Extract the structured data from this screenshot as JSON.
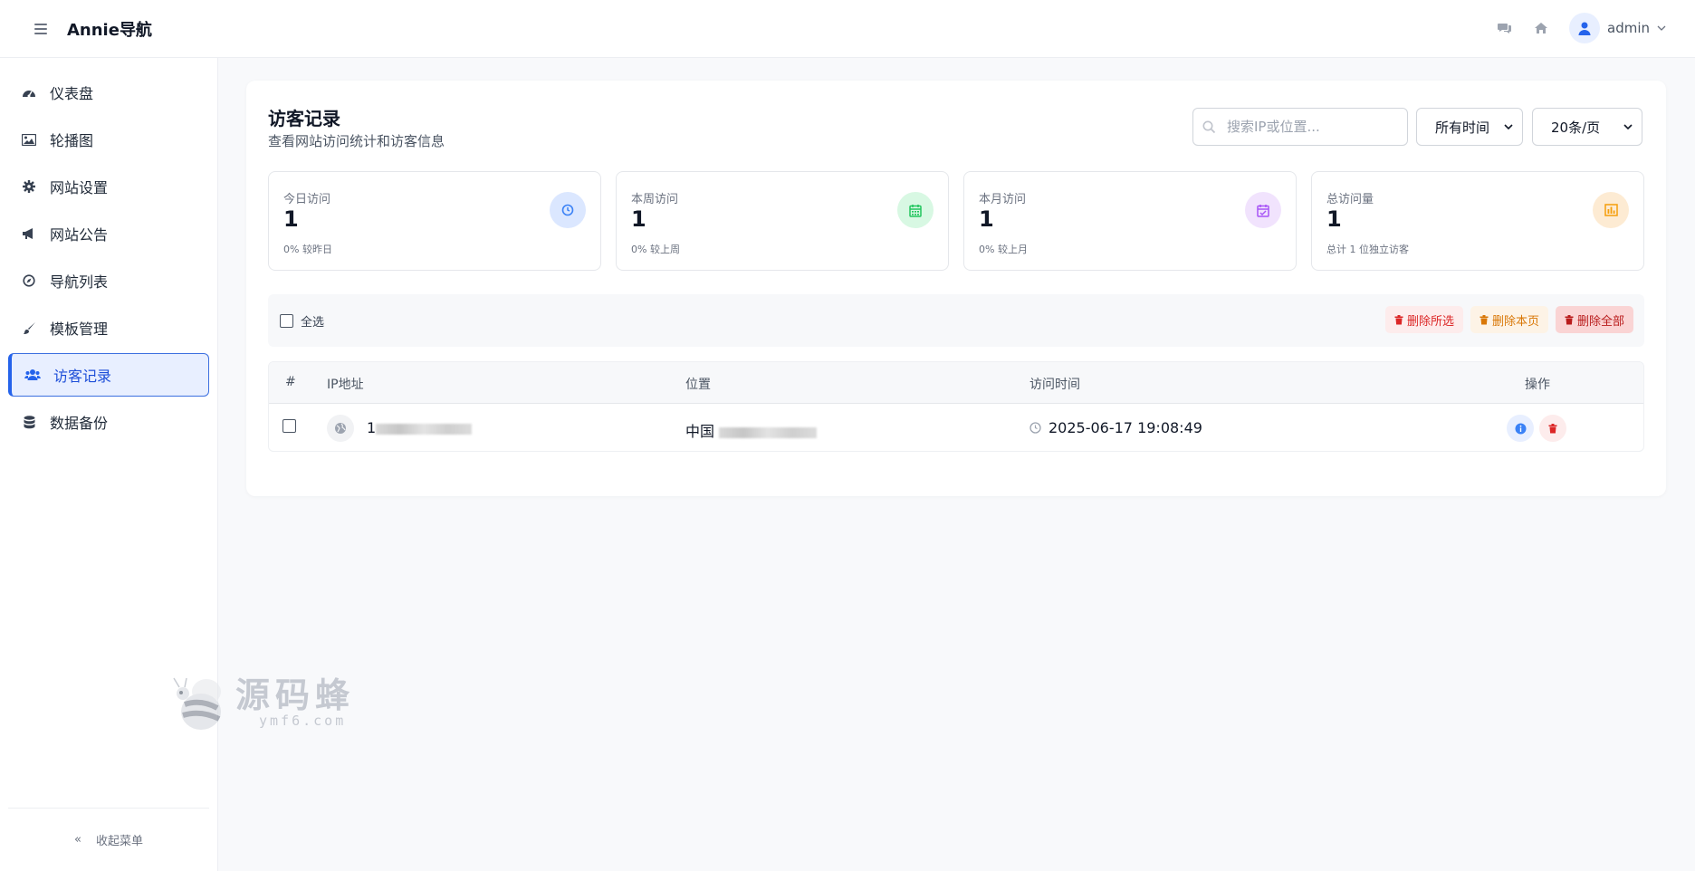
{
  "app": {
    "brand": "Annie导航"
  },
  "header": {
    "username": "admin"
  },
  "sidebar": {
    "items": [
      {
        "label": "仪表盘"
      },
      {
        "label": "轮播图"
      },
      {
        "label": "网站设置"
      },
      {
        "label": "网站公告"
      },
      {
        "label": "导航列表"
      },
      {
        "label": "模板管理"
      },
      {
        "label": "访客记录"
      },
      {
        "label": "数据备份"
      }
    ],
    "active": "访客记录",
    "collapse_label": "收起菜单"
  },
  "watermark": {
    "text": "源码蜂",
    "sub": "ymf6.com"
  },
  "page": {
    "title": "访客记录",
    "subtitle": "查看网站访问统计和访客信息"
  },
  "filters": {
    "search_placeholder": "搜索IP或位置...",
    "time_range": "所有时间",
    "page_size": "20条/页"
  },
  "stats": [
    {
      "label": "今日访问",
      "value": "1",
      "foot": "0% 较昨日",
      "icon": "clock-icon",
      "color": "#3b82f6",
      "bg": "#dbe7ff"
    },
    {
      "label": "本周访问",
      "value": "1",
      "foot": "0% 较上周",
      "icon": "calendar-icon",
      "color": "#22c55e",
      "bg": "#d8f8e3"
    },
    {
      "label": "本月访问",
      "value": "1",
      "foot": "0% 较上月",
      "icon": "calendar-check-icon",
      "color": "#a855f7",
      "bg": "#f1e3fd"
    },
    {
      "label": "总访问量",
      "value": "1",
      "foot": "总计 1 位独立访客",
      "icon": "bar-chart-icon",
      "color": "#f59e0b",
      "bg": "#fdebd3"
    }
  ],
  "toolbar": {
    "select_all": "全选",
    "delete_selected": "删除所选",
    "delete_page": "删除本页",
    "delete_all": "删除全部"
  },
  "table": {
    "columns": [
      "#",
      "IP地址",
      "位置",
      "访问时间",
      "操作"
    ],
    "rows": [
      {
        "ip_prefix": "1",
        "location_prefix": "中国 ",
        "time": "2025-06-17 19:08:49"
      }
    ]
  }
}
